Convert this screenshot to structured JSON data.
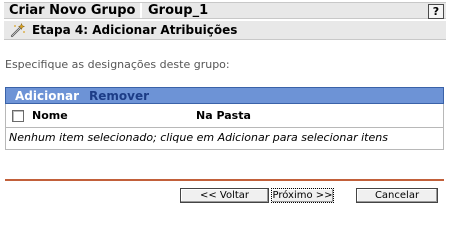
{
  "header": {
    "title": "Criar Novo Grupo",
    "group_name": "Group_1",
    "help_label": "?"
  },
  "step": {
    "title": "Etapa 4: Adicionar Atribuições",
    "icon": "wand-icon"
  },
  "instructions": "Especifique as designações deste grupo:",
  "actions": {
    "add_label": "Adicionar",
    "remove_label": "Remover"
  },
  "table": {
    "columns": [
      "Nome",
      "Na Pasta"
    ],
    "empty_message": "Nenhum item selecionado; clique em Adicionar para selecionar itens"
  },
  "footer": {
    "back_label": "<< Voltar",
    "next_label": "Próximo >>",
    "cancel_label": "Cancelar"
  },
  "colors": {
    "action_bar": "#6d93d6",
    "add_link": "#ffffff",
    "remove_link": "#1c3c86",
    "footer_divider": "#c2603a",
    "header_bg": "#e8e8e8"
  }
}
